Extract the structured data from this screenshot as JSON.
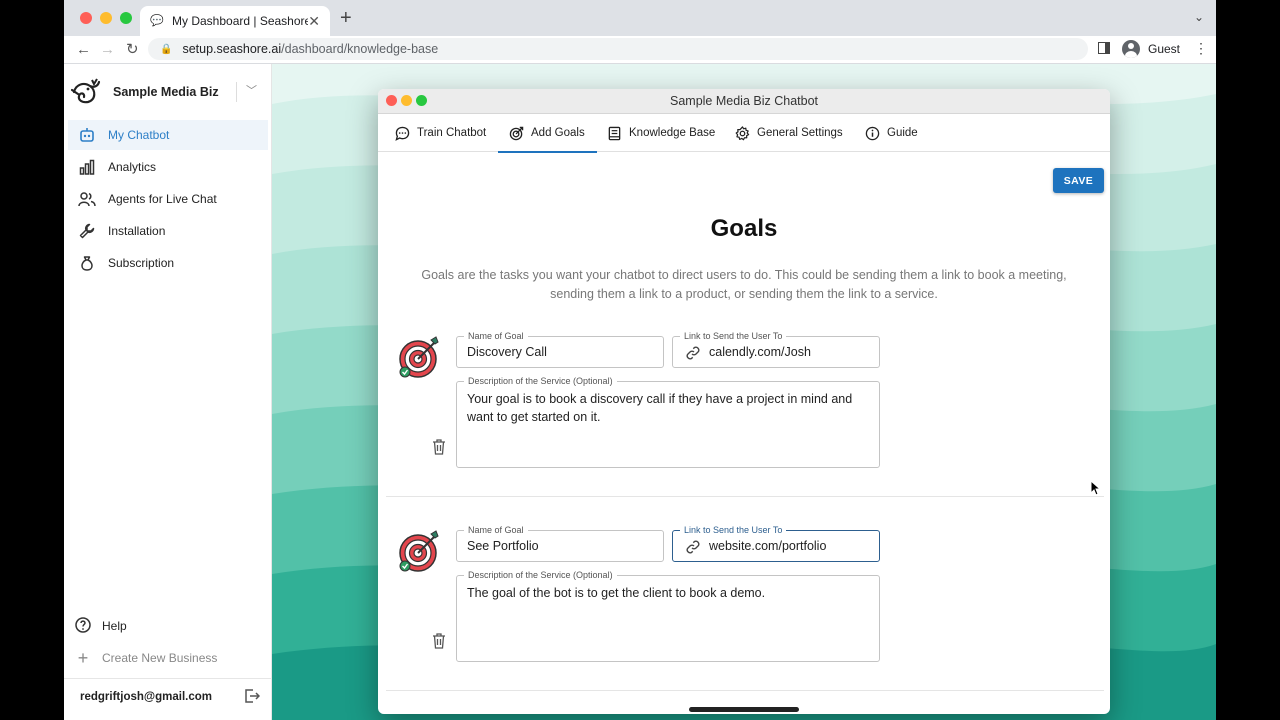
{
  "browser": {
    "tab_title": "My Dashboard | Seashore.AI",
    "tab_close": "✕",
    "new_tab": "+",
    "url_host": "setup.seashore.ai",
    "url_path": "/dashboard/knowledge-base",
    "profile_label": "Guest"
  },
  "sidebar": {
    "business_name": "Sample Media Biz",
    "items": [
      {
        "label": "My Chatbot",
        "icon": "robot-icon",
        "active": true
      },
      {
        "label": "Analytics",
        "icon": "bar-chart-icon"
      },
      {
        "label": "Agents for Live Chat",
        "icon": "users-icon"
      },
      {
        "label": "Installation",
        "icon": "wrench-icon"
      },
      {
        "label": "Subscription",
        "icon": "money-bag-icon"
      }
    ],
    "help_label": "Help",
    "create_label": "Create New Business",
    "user_email": "redgriftjosh@gmail.com"
  },
  "window": {
    "title": "Sample Media Biz Chatbot",
    "tabs": [
      {
        "label": "Train Chatbot",
        "icon": "chat-icon"
      },
      {
        "label": "Add Goals",
        "icon": "target-icon",
        "active": true
      },
      {
        "label": "Knowledge Base",
        "icon": "book-icon"
      },
      {
        "label": "General Settings",
        "icon": "gear-icon"
      },
      {
        "label": "Guide",
        "icon": "info-icon"
      }
    ],
    "save_label": "SAVE"
  },
  "goals": {
    "title": "Goals",
    "description": "Goals are the tasks you want your chatbot to direct users to do. This could be sending them a link to book a meeting, sending them a link to a product, or sending them the link to a service.",
    "name_label": "Name of Goal",
    "link_label": "Link to Send the User To",
    "desc_label": "Description of the Service (Optional)",
    "items": [
      {
        "name": "Discovery Call",
        "link": "calendly.com/Josh",
        "description": "Your goal is to book a discovery call if they have a project in mind and want to get started on it."
      },
      {
        "name": "See Portfolio",
        "link": "website.com/portfolio",
        "description": "The goal of the bot is to get the client to book a demo."
      }
    ]
  },
  "colors": {
    "accent": "#1e73be",
    "active_nav_bg": "#eef4fa",
    "teal_light": "#e3f5f1",
    "teal_dark": "#1a9a86"
  }
}
